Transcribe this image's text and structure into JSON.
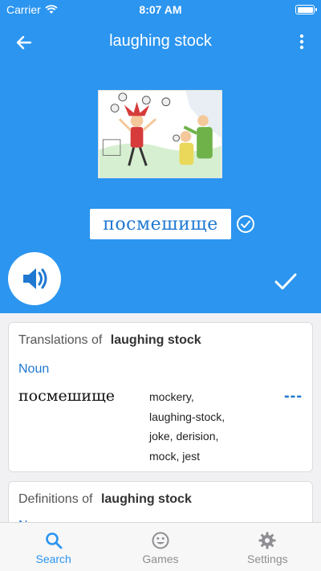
{
  "status_bar": {
    "carrier": "Carrier",
    "time": "8:07 AM"
  },
  "header": {
    "title": "laughing stock"
  },
  "word": {
    "native": "посмешище"
  },
  "translations_card": {
    "heading_prefix": "Translations of",
    "term": "laughing stock",
    "part_of_speech": "Noun",
    "translation": "посмешище",
    "synonyms": [
      "mockery,",
      "laughing-stock,",
      "joke, derision,",
      "mock, jest"
    ],
    "marker": "---"
  },
  "definitions_card": {
    "heading_prefix": "Definitions of",
    "term": "laughing stock",
    "part_of_speech": "Noun"
  },
  "tab_bar": {
    "items": [
      {
        "label": "Search",
        "icon": "search-icon"
      },
      {
        "label": "Games",
        "icon": "smiley-icon"
      },
      {
        "label": "Settings",
        "icon": "gear-icon"
      }
    ],
    "active": "Search"
  },
  "colors": {
    "accent": "#2b95f0",
    "link": "#1f78d1",
    "background": "#f1f1f4"
  }
}
